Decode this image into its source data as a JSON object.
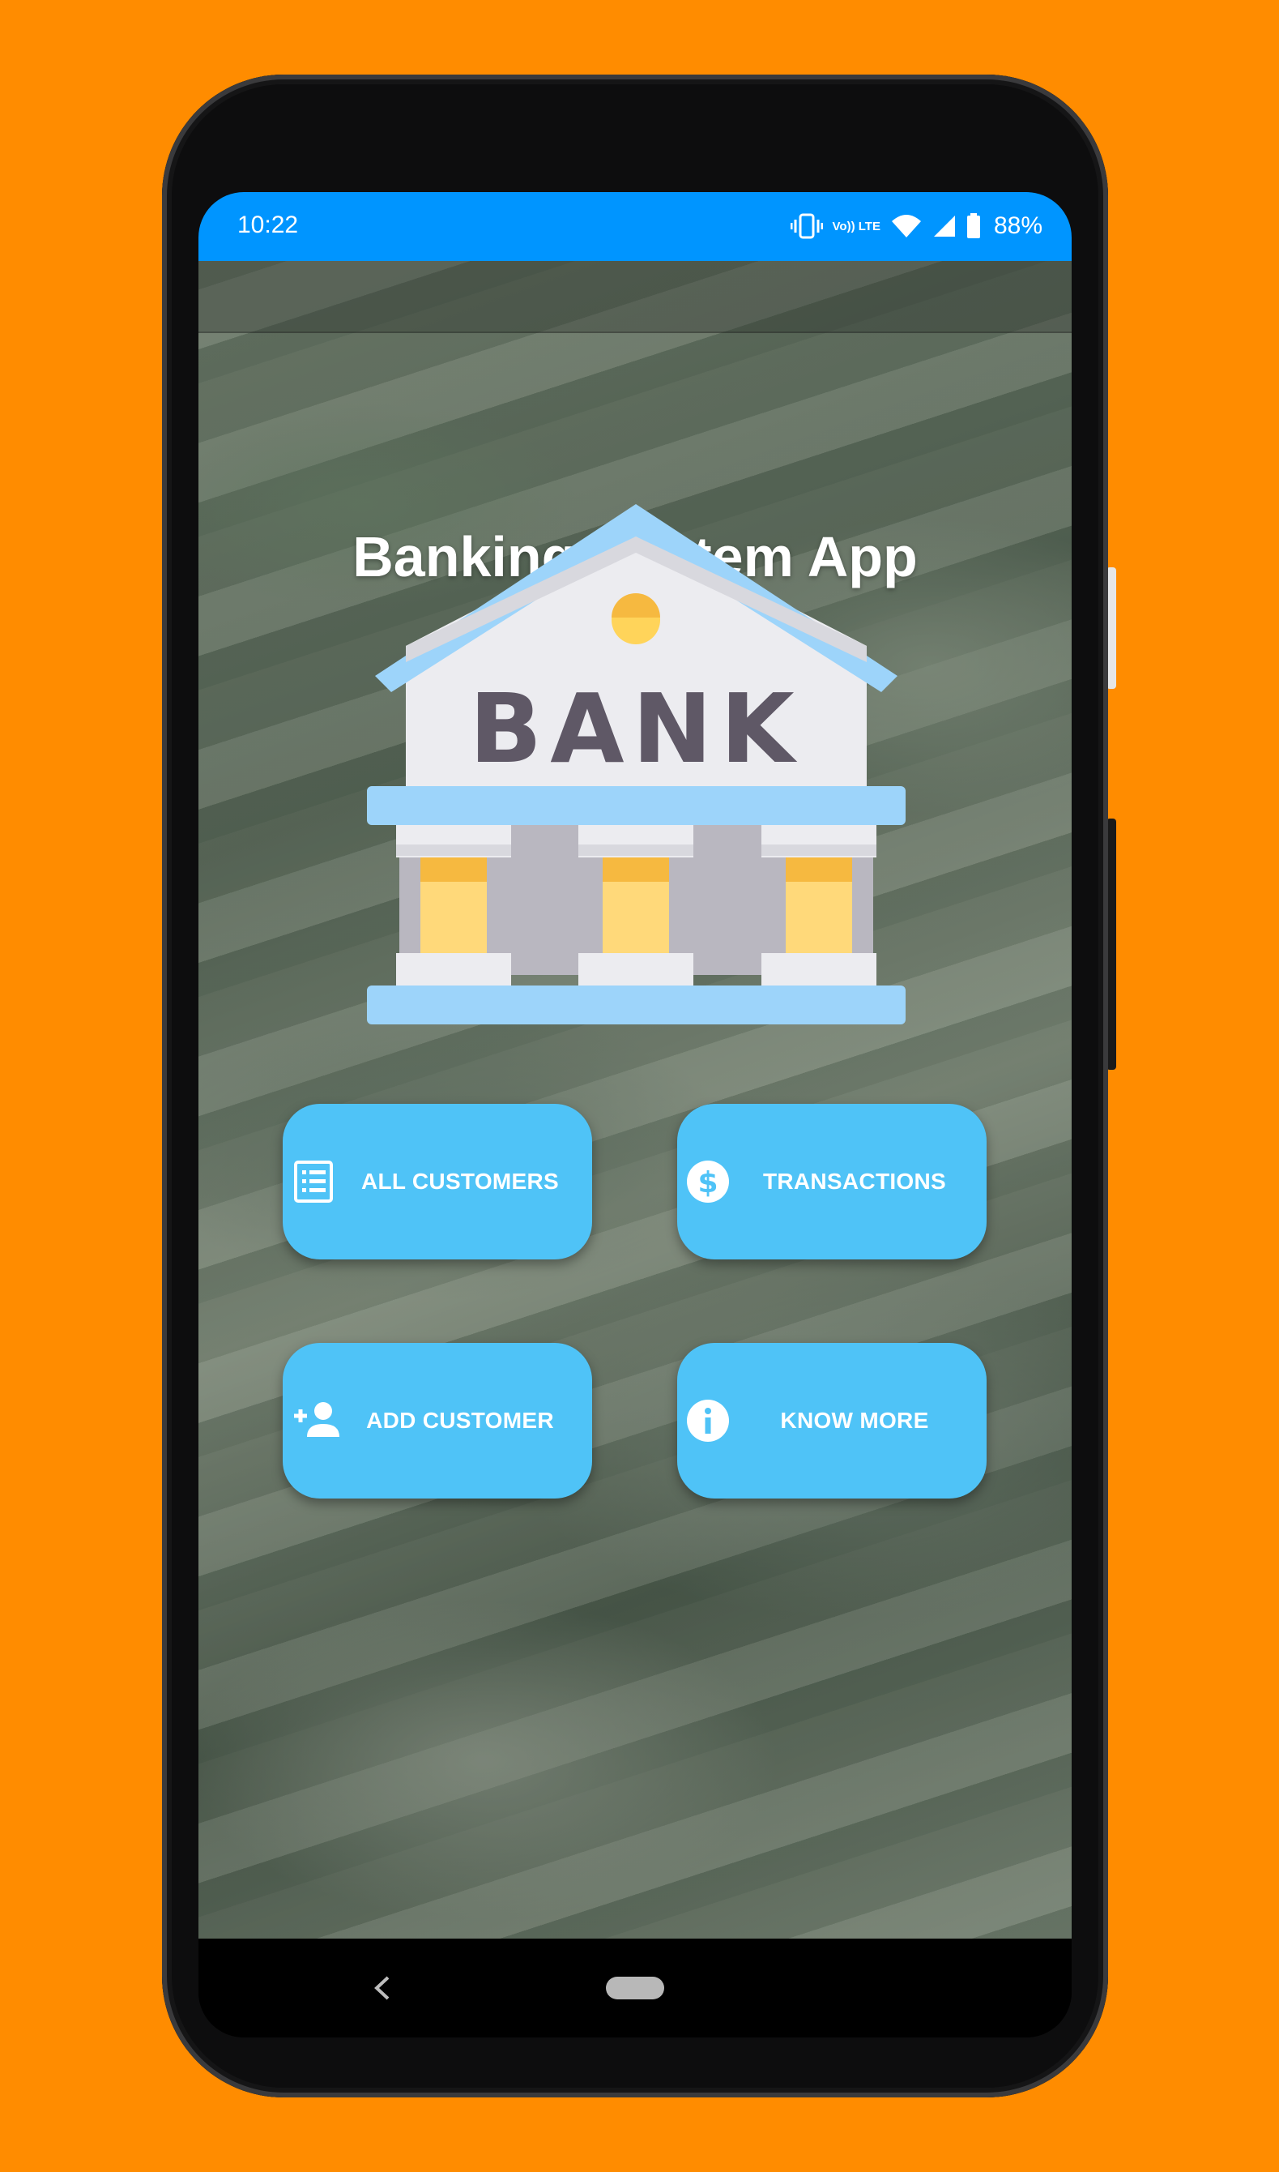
{
  "status_bar": {
    "time": "10:22",
    "network_label": "Vo)) LTE",
    "battery": "88%",
    "background": "#0095FF",
    "icons": [
      "vibrate-icon",
      "volte-icon",
      "wifi-icon",
      "signal-icon",
      "battery-icon"
    ]
  },
  "app": {
    "title": "Banking System App",
    "logo_text": "BANK"
  },
  "buttons": [
    {
      "label": "ALL CUSTOMERS",
      "icon": "list-icon"
    },
    {
      "label": "TRANSACTIONS",
      "icon": "dollar-icon"
    },
    {
      "label": "ADD CUSTOMER",
      "icon": "add-person-icon"
    },
    {
      "label": "KNOW MORE",
      "icon": "info-icon"
    }
  ],
  "nav_bar": {
    "icons": [
      "back-icon",
      "home-pill"
    ]
  },
  "colors": {
    "page_background": "#FF8C00",
    "button": "#4FC3F7",
    "status_bar": "#0095FF"
  }
}
